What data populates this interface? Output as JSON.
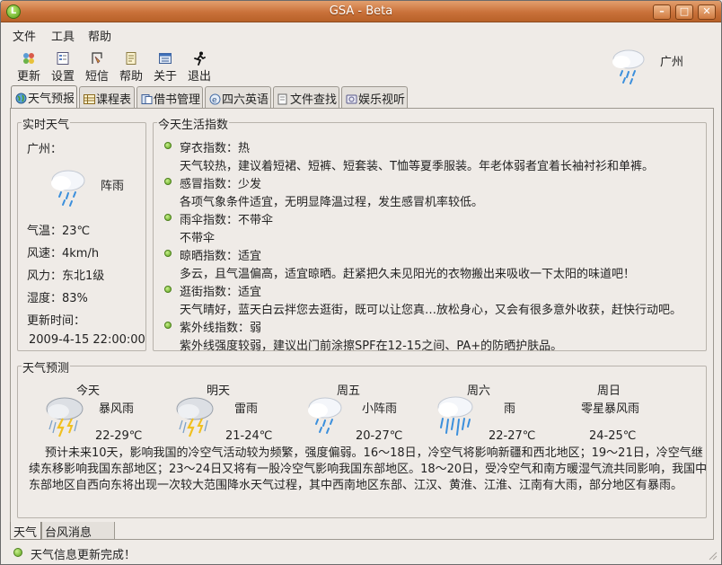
{
  "window": {
    "title": "GSA - Beta",
    "app_icon": "L"
  },
  "menubar": [
    "文件",
    "工具",
    "帮助"
  ],
  "toolbar": [
    {
      "label": "更新",
      "icon": "update-icon"
    },
    {
      "label": "设置",
      "icon": "settings-icon"
    },
    {
      "label": "短信",
      "icon": "sms-icon"
    },
    {
      "label": "帮助",
      "icon": "help-icon"
    },
    {
      "label": "关于",
      "icon": "about-icon"
    },
    {
      "label": "退出",
      "icon": "exit-icon"
    }
  ],
  "top_city": "广州",
  "tabs": [
    "天气预报",
    "课程表",
    "借书管理",
    "四六英语",
    "文件查找",
    "娱乐视听"
  ],
  "realtime": {
    "title": "实时天气",
    "city": "广州：",
    "condition": "阵雨",
    "temperature": "气温：23℃",
    "wind_speed": "风速：4km/h",
    "wind_force": "风力：东北1级",
    "humidity": "湿度：83%",
    "update_label": "更新时间：",
    "update_time": "2009-4-15 22:00:00"
  },
  "life_index": {
    "title": "今天生活指数",
    "items": [
      {
        "title": "穿衣指数：热",
        "desc": "天气较热，建议着短裙、短裤、短套装、T恤等夏季服装。年老体弱者宜着长袖衬衫和单裤。"
      },
      {
        "title": "感冒指数：少发",
        "desc": "各项气象条件适宜，无明显降温过程，发生感冒机率较低。"
      },
      {
        "title": "雨伞指数：不带伞",
        "desc": "不带伞"
      },
      {
        "title": "晾晒指数：适宜",
        "desc": "多云，且气温偏高，适宜晾晒。赶紧把久未见阳光的衣物搬出来吸收一下太阳的味道吧！"
      },
      {
        "title": "逛街指数：适宜",
        "desc": "天气晴好，蓝天白云拌您去逛街，既可以让您真…放松身心，又会有很多意外收获，赶快行动吧。"
      },
      {
        "title": "紫外线指数：弱",
        "desc": "紫外线强度较弱，建议出门前涂擦SPF在12-15之间、PA+的防晒护肤品。"
      }
    ]
  },
  "forecast": {
    "title": "天气预测",
    "days": [
      {
        "day": "今天",
        "condition": "暴风雨",
        "temp": "22-29℃",
        "icon": "thunderstorm-icon"
      },
      {
        "day": "明天",
        "condition": "雷雨",
        "temp": "21-24℃",
        "icon": "thunderstorm-icon"
      },
      {
        "day": "周五",
        "condition": "小阵雨",
        "temp": "20-27℃",
        "icon": "light-shower-icon"
      },
      {
        "day": "周六",
        "condition": "雨",
        "temp": "22-27℃",
        "icon": "rain-icon"
      },
      {
        "day": "周日",
        "condition": "零星暴风雨",
        "temp": "24-25℃",
        "icon": ""
      }
    ],
    "summary": "预计未来10天，影响我国的冷空气活动较为频繁，强度偏弱。16～18日，冷空气将影响新疆和西北地区；19～21日，冷空气继续东移影响我国东部地区；23～24日又将有一股冷空气影响我国东部地区。18～20日，受冷空气和南方暖湿气流共同影响，我国中东部地区自西向东将出现一次较大范围降水天气过程，其中西南地区东部、江汉、黄淮、江淮、江南有大雨，部分地区有暴雨。"
  },
  "bottom_tabs": [
    "天气",
    "台风消息"
  ],
  "status": "天气信息更新完成！"
}
